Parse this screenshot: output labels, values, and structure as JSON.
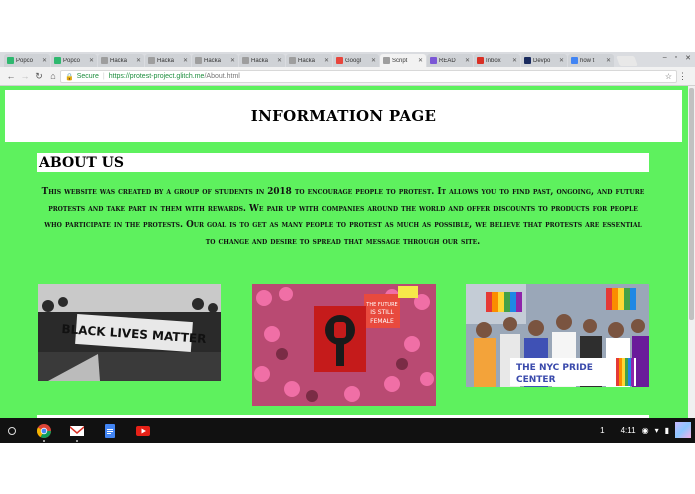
{
  "browser": {
    "tabs": [
      {
        "label": "Popco",
        "color": "#2fb86f",
        "active": false
      },
      {
        "label": "Popco",
        "color": "#2fb86f",
        "active": false
      },
      {
        "label": "Hacka",
        "color": "#9e9e9e",
        "active": false
      },
      {
        "label": "Hacka",
        "color": "#9e9e9e",
        "active": false
      },
      {
        "label": "Hacka",
        "color": "#9e9e9e",
        "active": false
      },
      {
        "label": "Hacka",
        "color": "#9e9e9e",
        "active": false
      },
      {
        "label": "Hacka",
        "color": "#9e9e9e",
        "active": false
      },
      {
        "label": "Googl",
        "color": "#e8453c",
        "active": false
      },
      {
        "label": "Script",
        "color": "#9e9e9e",
        "active": true
      },
      {
        "label": "READ",
        "color": "#7b57d6",
        "active": false
      },
      {
        "label": "Inbox",
        "color": "#d93025",
        "active": false
      },
      {
        "label": "Devpo",
        "color": "#1a2b5f",
        "active": false
      },
      {
        "label": "how t",
        "color": "#4285f4",
        "active": false
      }
    ],
    "secure_label": "Secure",
    "url_host": "https://protest-project.glitch.me",
    "url_path": "/About.html"
  },
  "page": {
    "title": "INFORMATION PAGE",
    "about_heading": "ABOUT US",
    "about_text": "This website was created by a group of students in 2018 to encourage people to protest. It allows you to find past, ongoing, and future protests and take part in them with rewards. We pair up with companies around the world and offer discounts to products for people who participate in the protests. Our goal is to get as many people to protest as much as possible, we believe that protests are essential to change and desire to spread that message through our site.",
    "photos": [
      {
        "name": "black-lives-matter-photo",
        "banner": "BLACK LIVES MATTER"
      },
      {
        "name": "womens-march-photo",
        "banner": "THE FUTURE IS STILL FEMALE"
      },
      {
        "name": "nyc-pride-photo",
        "banner": "THE NYC PRIDE CENTER"
      }
    ],
    "background_color": "#5ef15e"
  },
  "shelf": {
    "apps": [
      "chrome-icon",
      "gmail-icon",
      "docs-icon",
      "youtube-icon"
    ],
    "notification_count": "1",
    "time": "4:11"
  }
}
